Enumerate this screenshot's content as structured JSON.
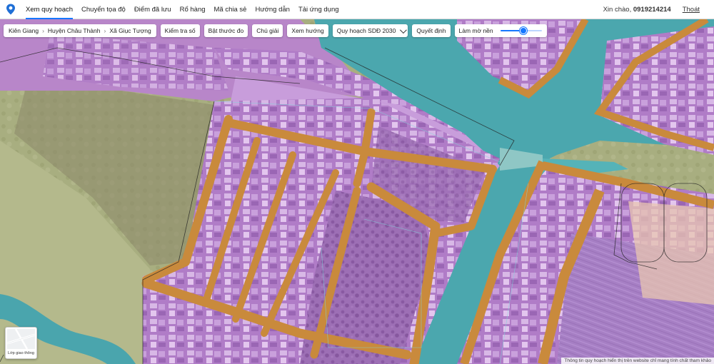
{
  "nav": {
    "items": [
      {
        "label": "Xem quy hoạch",
        "active": true
      },
      {
        "label": "Chuyển tọa độ",
        "active": false
      },
      {
        "label": "Điểm đã lưu",
        "active": false
      },
      {
        "label": "Rổ hàng",
        "active": false
      },
      {
        "label": "Mã chia sẻ",
        "active": false
      },
      {
        "label": "Hướng dẫn",
        "active": false
      },
      {
        "label": "Tải ứng dụng",
        "active": false
      }
    ]
  },
  "user": {
    "greeting": "Xin chào,",
    "phone": "0919214214",
    "logout": "Thoát"
  },
  "breadcrumb": {
    "province": "Kiên Giang",
    "district": "Huyện Châu Thành",
    "commune": "Xã Giục Tượng"
  },
  "toolbar": {
    "check_parcel": "Kiểm tra số",
    "ruler": "Bật thước đo",
    "legend": "Chú giải",
    "direction": "Xem hướng",
    "plan_select": "Quy hoạch SDĐ 2030",
    "decision": "Quyết định",
    "fade_label": "Làm mờ nền",
    "fade_level": 0.55
  },
  "map": {
    "layer_button": "Lớp giao thông",
    "disclaimer": "Thông tin quy hoạch hiển thị trên website chỉ mang tính chất tham khảo",
    "colors": {
      "agri": "#a6ae7e",
      "residential": "#b07cc7",
      "road": "#c98a3c",
      "water": "#4aa9b1",
      "boundary": "#222222"
    }
  }
}
